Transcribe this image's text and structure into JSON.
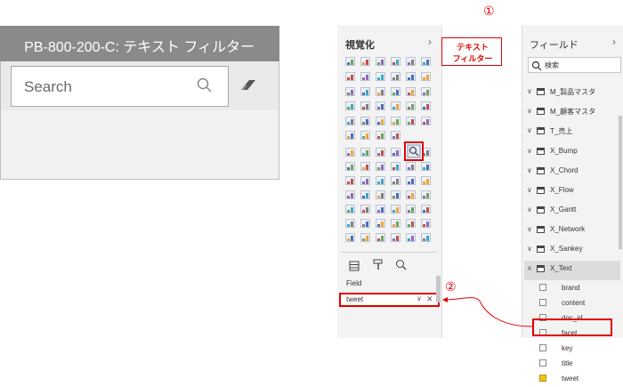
{
  "filter_visual": {
    "title": "PB-800-200-C: テキスト フィルター",
    "search_placeholder": "Search",
    "search_icon": "search-icon",
    "eraser_icon": "eraser-icon"
  },
  "visualizations_pane": {
    "title": "視覚化",
    "chevron": "›",
    "build_tabs": [
      "fields-well-icon",
      "format-paintbrush-icon",
      "analytics-magnifier-icon"
    ],
    "field_well_label": "Field",
    "field_well_value": "tweet",
    "field_well_chevron": "∨",
    "field_well_remove": "✕"
  },
  "callout": {
    "line1": "テキスト",
    "line2": "フィルター",
    "step1": "①",
    "step2": "②",
    "color": "#e00000"
  },
  "fields_pane": {
    "title": "フィールド",
    "chevron": "›",
    "search_placeholder": "検索",
    "tables": [
      {
        "label": "M_製品マスタ"
      },
      {
        "label": "M_顧客マスタ"
      },
      {
        "label": "T_売上"
      },
      {
        "label": "X_Bump"
      },
      {
        "label": "X_Chord"
      },
      {
        "label": "X_Flow"
      },
      {
        "label": "X_Gantt"
      },
      {
        "label": "X_Network"
      },
      {
        "label": "X_Sankey"
      },
      {
        "label": "X_Text"
      }
    ],
    "expand_collapsed": "∨",
    "expand_open": "∧",
    "x_text_fields": [
      {
        "label": "brand",
        "checked": false
      },
      {
        "label": "content",
        "checked": false
      },
      {
        "label": "doc_id",
        "checked": false
      },
      {
        "label": "facet",
        "checked": false
      },
      {
        "label": "key",
        "checked": false
      },
      {
        "label": "title",
        "checked": false
      },
      {
        "label": "tweet",
        "checked": true
      }
    ],
    "checked_color": "#f1c40f"
  }
}
